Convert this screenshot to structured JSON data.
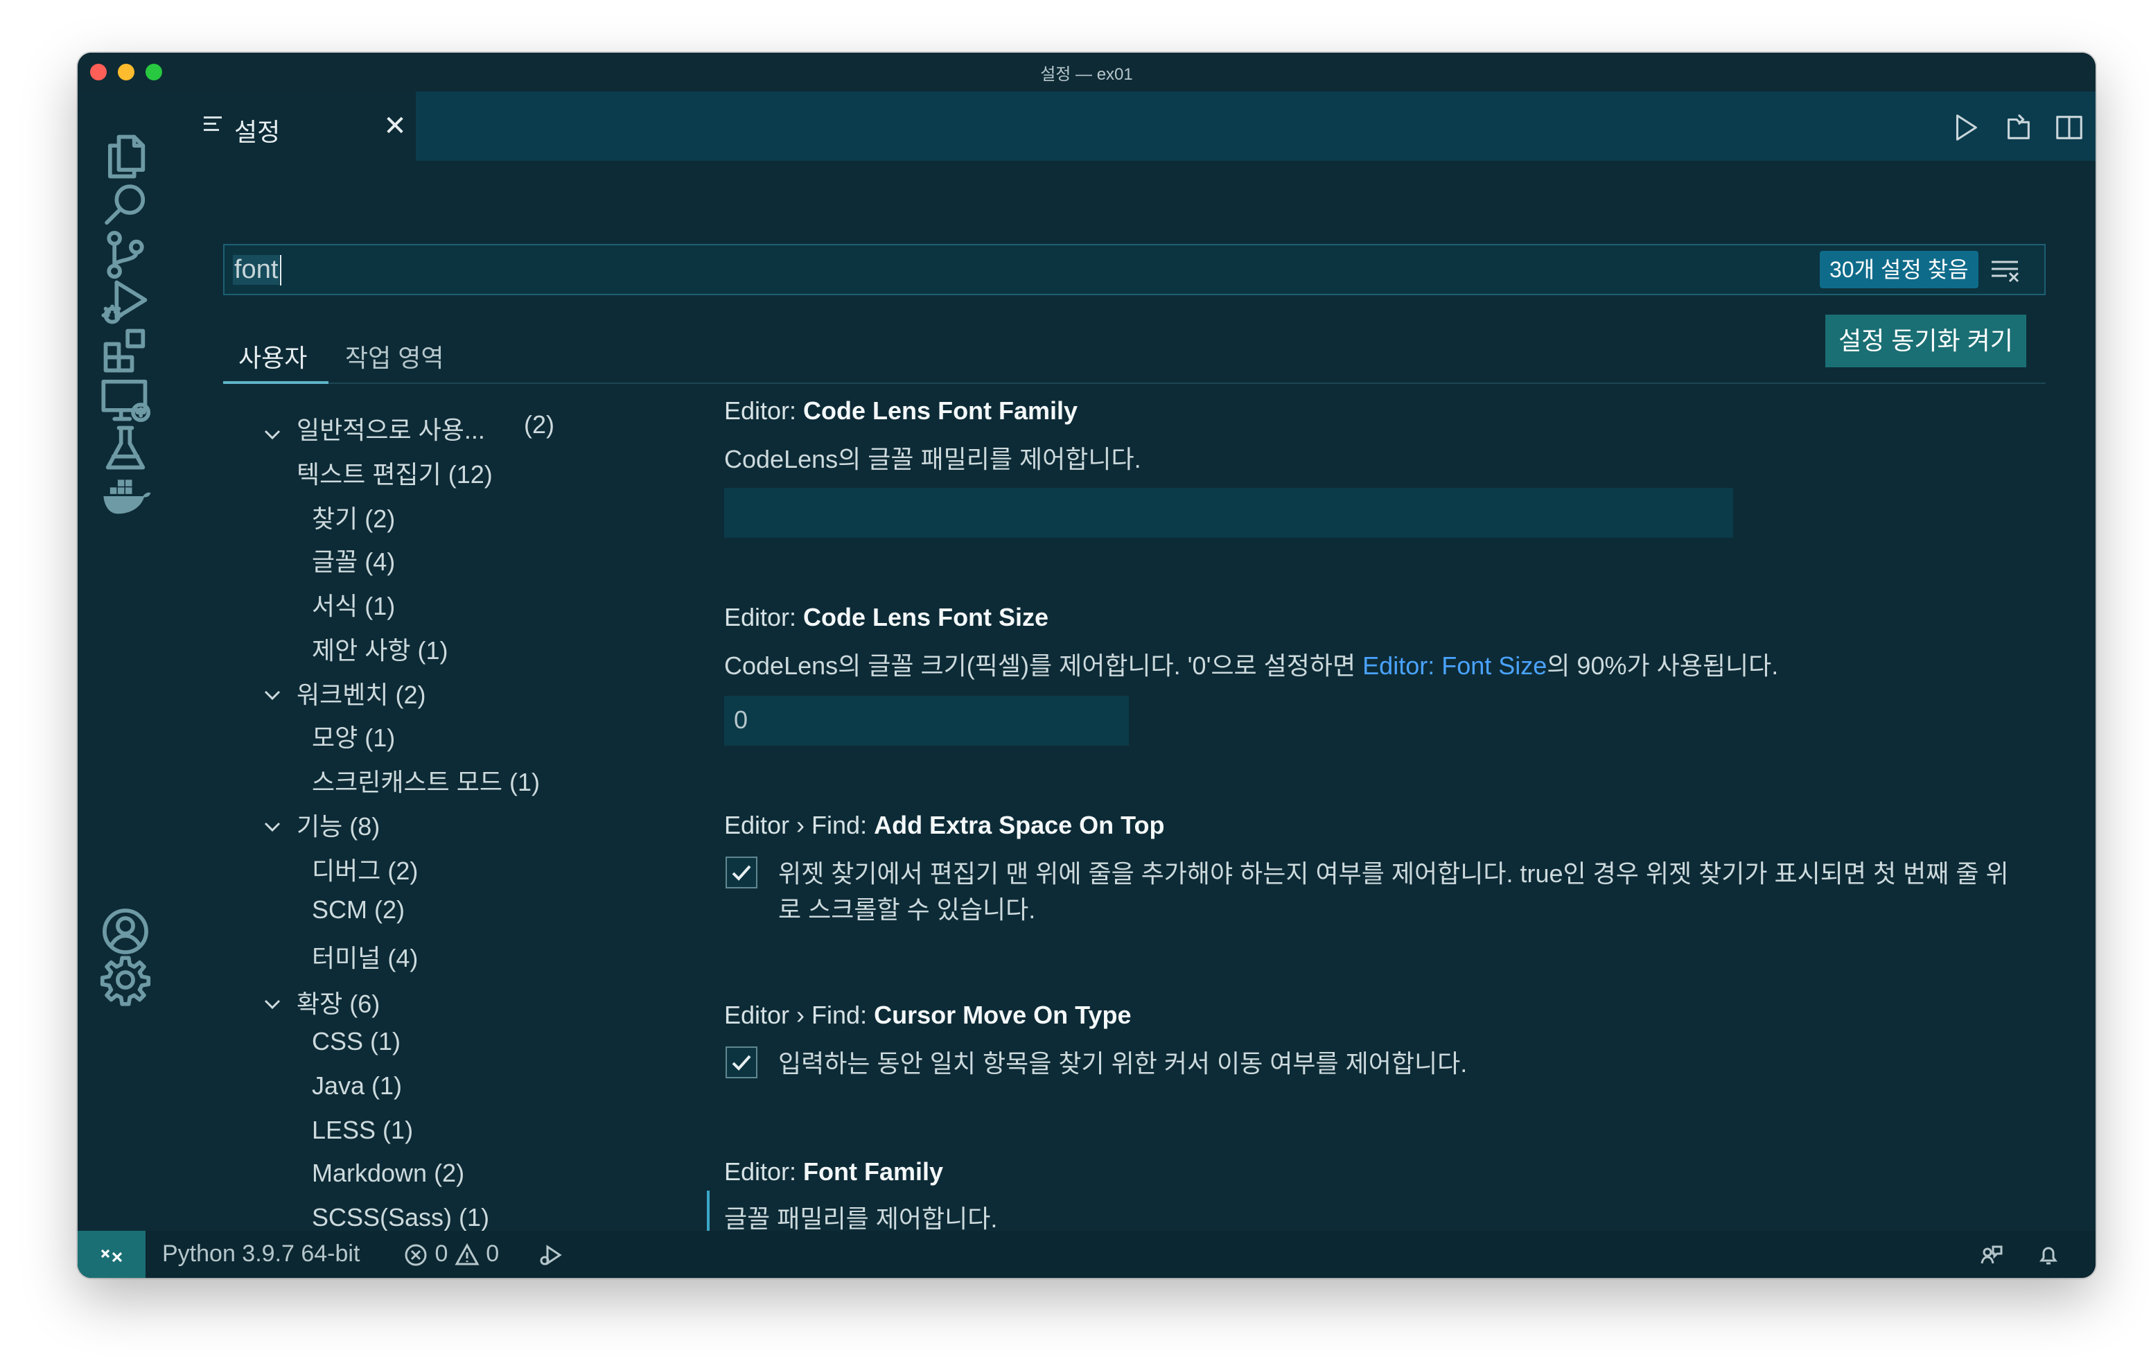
{
  "window": {
    "title": "설정 — ex01"
  },
  "colors": {
    "accent": "#0f6b8a",
    "sync_button": "#1a6f74",
    "link": "#4aa3ff",
    "background": "#0d2b36"
  },
  "activity_bar": {
    "icons": [
      "files-icon",
      "search-icon",
      "source-control-icon",
      "run-debug-icon",
      "extensions-icon",
      "remote-explorer-icon",
      "testing-icon",
      "docker-icon",
      "account-icon",
      "manage-gear-icon"
    ]
  },
  "tab": {
    "label": "설정",
    "close": "✕"
  },
  "search": {
    "query": "font",
    "result_badge": "30개 설정 찾음"
  },
  "scope_tabs": {
    "user": "사용자",
    "workspace": "작업 영역"
  },
  "sync_button": "설정 동기화 켜기",
  "toc": [
    {
      "label": "일반적으로 사용...",
      "count": "(2)"
    },
    {
      "label": "텍스트 편집기 (12)"
    },
    {
      "label": "찾기 (2)"
    },
    {
      "label": "글꼴 (4)"
    },
    {
      "label": "서식 (1)"
    },
    {
      "label": "제안 사항 (1)"
    },
    {
      "label": "워크벤치 (2)"
    },
    {
      "label": "모양 (1)"
    },
    {
      "label": "스크린캐스트 모드 (1)"
    },
    {
      "label": "기능 (8)"
    },
    {
      "label": "디버그 (2)"
    },
    {
      "label": "SCM (2)"
    },
    {
      "label": "터미널 (4)"
    },
    {
      "label": "확장 (6)"
    },
    {
      "label": "CSS (1)"
    },
    {
      "label": "Java (1)"
    },
    {
      "label": "LESS (1)"
    },
    {
      "label": "Markdown (2)"
    },
    {
      "label": "SCSS(Sass) (1)"
    }
  ],
  "settings": [
    {
      "category": "Editor: ",
      "name": "Code Lens Font Family",
      "description": "CodeLens의 글꼴 패밀리를 제어합니다.",
      "value": ""
    },
    {
      "category": "Editor: ",
      "name": "Code Lens Font Size",
      "description_pre": "CodeLens의 글꼴 크기(픽셀)를 제어합니다. '0'으로 설정하면 ",
      "description_link": "Editor: Font Size",
      "description_post": "의 90%가 사용됩니다.",
      "value": "0"
    },
    {
      "category": "Editor › Find: ",
      "name": "Add Extra Space On Top",
      "description_line1": "위젯 찾기에서 편집기 맨 위에 줄을 추가해야 하는지 여부를 제어합니다. true인 경우 위젯 찾기가 표시되면 첫 번째 줄 위",
      "description_line2": "로 스크롤할 수 있습니다.",
      "checked": true
    },
    {
      "category": "Editor › Find: ",
      "name": "Cursor Move On Type",
      "description": "입력하는 동안 일치 항목을 찾기 위한 커서 이동 여부를 제어합니다.",
      "checked": true
    },
    {
      "category": "Editor: ",
      "name": "Font Family",
      "description": "글꼴 패밀리를 제어합니다."
    }
  ],
  "status_bar": {
    "interpreter": "Python 3.9.7 64-bit",
    "errors": "0",
    "warnings": "0"
  }
}
